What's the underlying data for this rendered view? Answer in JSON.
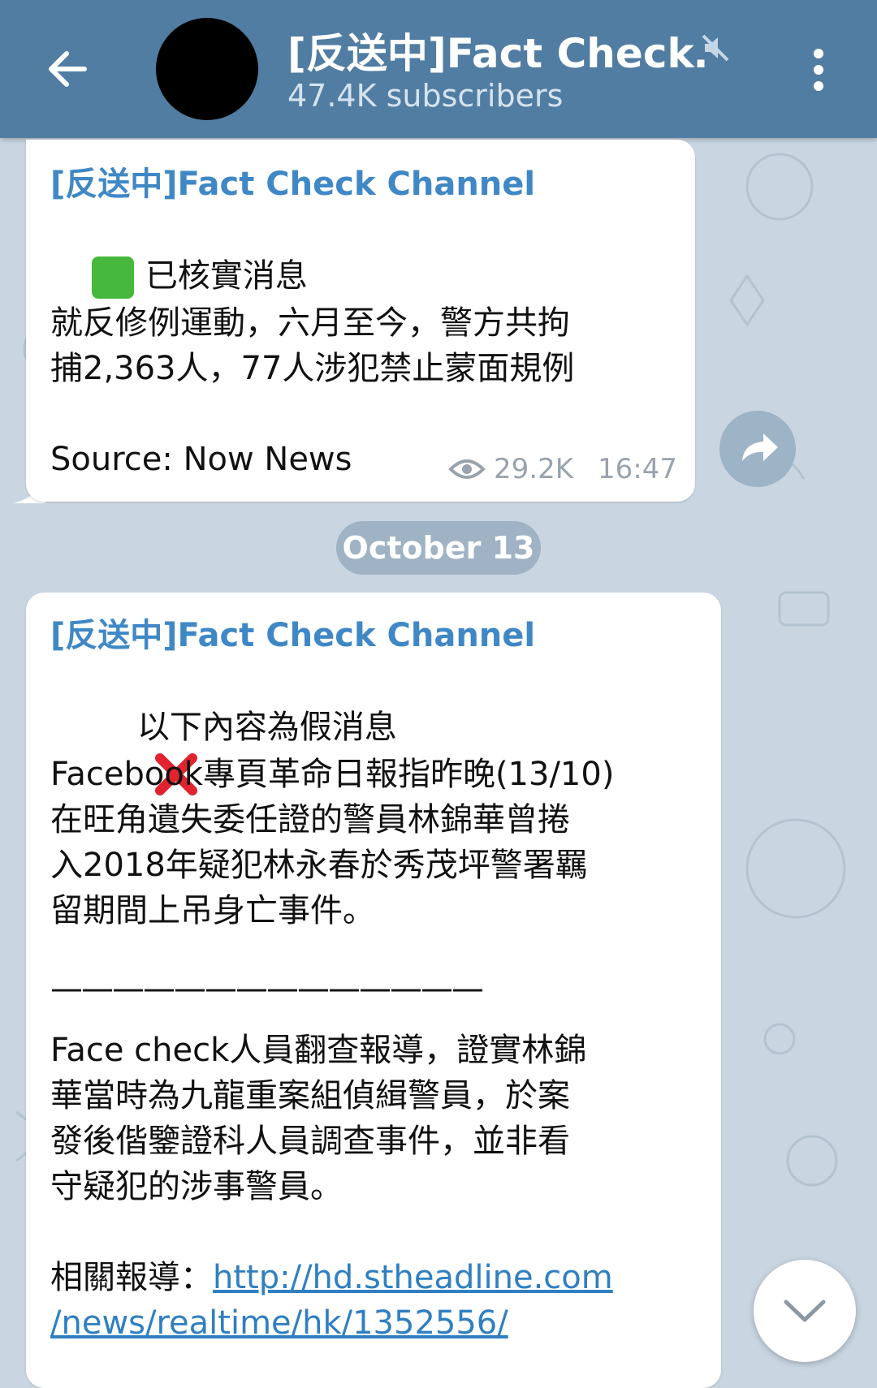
{
  "header": {
    "title": "[反送中]Fact Check…",
    "subscribers": "47.4K subscribers"
  },
  "messages": [
    {
      "sender": "[反送中]Fact Check Channel",
      "tag_line": "已核實消息",
      "body_lines": [
        "就反修例運動，六月至今，警方共拘",
        "捕2,363人，77人涉犯禁止蒙面規例"
      ],
      "source": "Source: Now News",
      "views": "29.2K",
      "time": "16:47"
    },
    {
      "sender": "[反送中]Fact Check Channel",
      "tag_line": "以下內容為假消息",
      "para1_lines": [
        "Facebook專頁革命日報指昨晚(13/10)",
        "在旺角遺失委任證的警員林錦華曾捲",
        "入2018年疑犯林永春於秀茂坪警署羈",
        "留期間上吊身亡事件。"
      ],
      "divider": "——————————————",
      "para2_lines": [
        "Face check人員翻查報導，證實林錦",
        "華當時為九龍重案組偵緝警員，於案",
        "發後偕鑒證科人員調查事件，並非看",
        "守疑犯的涉事警員。"
      ],
      "related_label": "相關報導：",
      "link_line1": "http://hd.stheadline.com",
      "link_line2": "/news/realtime/hk/1352556/"
    }
  ],
  "date_separator": "October 13",
  "colors": {
    "header_bg": "#517da2",
    "sender": "#3f88c5",
    "link": "#2f7fc1",
    "chat_bg": "#c9d6e1"
  },
  "icons": [
    "back-arrow-icon",
    "mute-icon",
    "more-vert-icon",
    "check-mark-icon",
    "cross-mark-icon",
    "eye-icon",
    "share-icon",
    "chevron-down-icon"
  ]
}
